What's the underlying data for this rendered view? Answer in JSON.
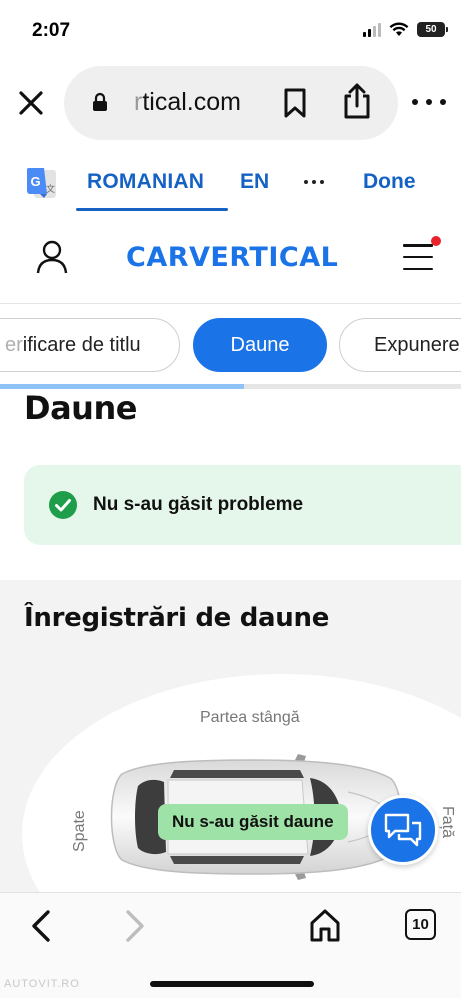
{
  "status_bar": {
    "time": "2:07",
    "battery": "50"
  },
  "browser": {
    "url_faded": "r",
    "url_main": "tical.com",
    "icons": [
      "close-icon",
      "lock-icon",
      "bookmark-icon",
      "share-icon",
      "more-icon"
    ]
  },
  "translate_bar": {
    "language_selected": "ROMANIAN",
    "language_other": "EN",
    "done_label": "Done"
  },
  "site_header": {
    "logo_text": "CARVERTICAL"
  },
  "tabs": {
    "items": [
      {
        "faded": "er",
        "label": "ificare de titlu"
      },
      {
        "label": "Daune",
        "active": true
      },
      {
        "label": "Expunere"
      }
    ],
    "progress_fraction": 0.53
  },
  "main": {
    "section_title": "Daune",
    "status_message": "Nu s-au găsit probleme",
    "records_title": "Înregistrări de daune",
    "car_diagram": {
      "label_left": "Partea stângă",
      "label_rear": "Spate",
      "label_front": "Față",
      "badge": "Nu s-au găsit daune"
    }
  },
  "bottom_toolbar": {
    "tab_count": "10"
  },
  "watermark": "AUTOVIT.RO",
  "colors": {
    "brand_blue": "#1b73e8",
    "link_blue": "#1662c4",
    "success_bg": "#e5f7ea",
    "success_green": "#1e9e4a",
    "badge_green": "#9ee2a7",
    "notification_red": "#e8232b"
  }
}
